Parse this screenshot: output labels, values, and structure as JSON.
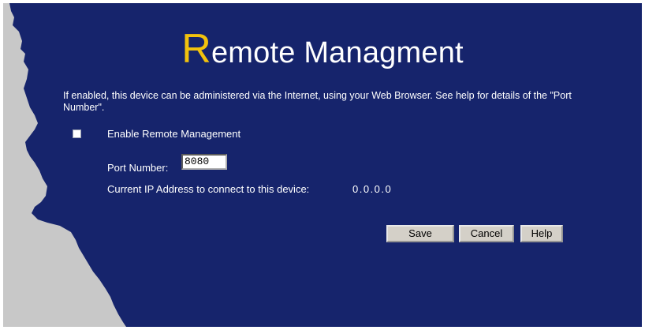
{
  "title": {
    "first_letter": "R",
    "rest": "emote Managment"
  },
  "description": "If enabled, this device can be administered via the Internet, using your Web Browser. See help for details of the \"Port Number\".",
  "enable_remote": {
    "label": "Enable Remote Management",
    "checked": false
  },
  "port": {
    "label": "Port Number:",
    "value": "8080"
  },
  "ip": {
    "label": "Current IP Address to connect to this device:",
    "value": "0.0.0.0"
  },
  "buttons": {
    "save": "Save",
    "cancel": "Cancel",
    "help": "Help"
  },
  "colors": {
    "background": "#16246c",
    "title_accent": "#f2c20d",
    "edge": "#c8c8c8"
  }
}
